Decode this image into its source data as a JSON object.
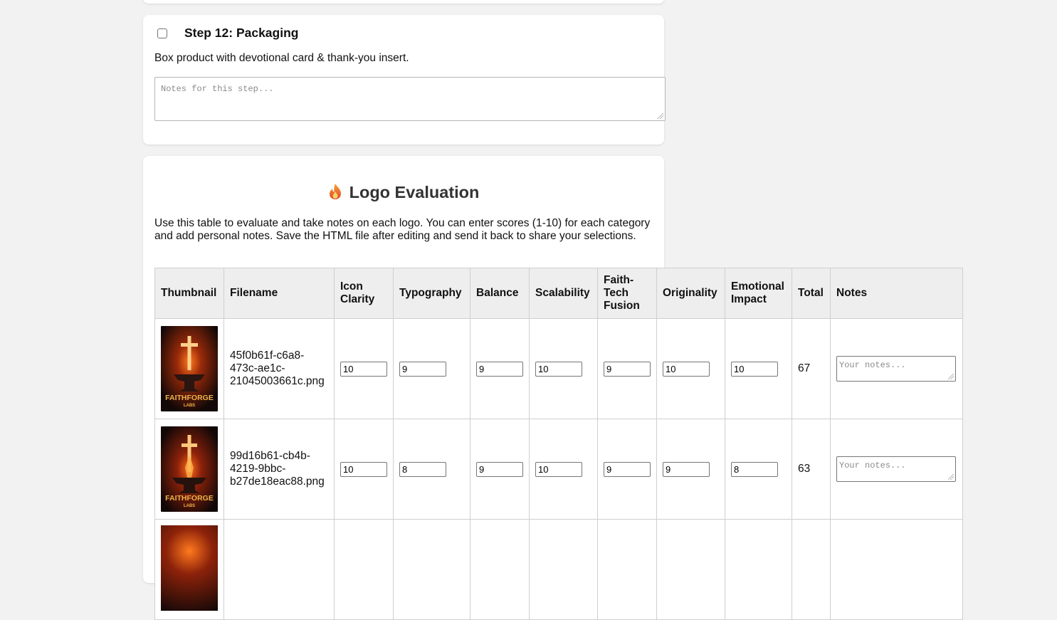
{
  "step": {
    "title": "Step 12: Packaging",
    "description": "Box product with devotional card & thank-you insert.",
    "notes_placeholder": "Notes for this step..."
  },
  "evaluation": {
    "title": "Logo Evaluation",
    "intro": "Use this table to evaluate and take notes on each logo. You can enter scores (1-10) for each category and add personal notes. Save the HTML file after editing and send it back to share your selections.",
    "columns": {
      "thumbnail": "Thumbnail",
      "filename": "Filename",
      "icon_clarity": "Icon Clarity",
      "typography": "Typography",
      "balance": "Balance",
      "scalability": "Scalability",
      "faith_tech_fusion": "Faith-Tech Fusion",
      "originality": "Originality",
      "emotional_impact": "Emotional Impact",
      "total": "Total",
      "notes": "Notes"
    },
    "notes_placeholder": "Your notes...",
    "rows": [
      {
        "filename": "45f0b61f-c6a8-473c-ae1c-21045003661c.png",
        "thumb_text": "FAITHFORGE",
        "thumb_sub": "LABS",
        "icon_clarity": "10",
        "typography": "9",
        "balance": "9",
        "scalability": "10",
        "faith_tech_fusion": "9",
        "originality": "10",
        "emotional_impact": "10",
        "total": "67"
      },
      {
        "filename": "99d16b61-cb4b-4219-9bbc-b27de18eac88.png",
        "thumb_text": "FAITHFORGE",
        "thumb_sub": "LABS",
        "icon_clarity": "10",
        "typography": "8",
        "balance": "9",
        "scalability": "10",
        "faith_tech_fusion": "9",
        "originality": "9",
        "emotional_impact": "8",
        "total": "63"
      }
    ]
  },
  "colors": {
    "page_bg": "#f2f2f2",
    "card_bg": "#ffffff",
    "header_bg": "#eeeeee",
    "title": "#333333",
    "logo_glow": "#ff6a1a",
    "logo_text": "#f2b14a"
  },
  "icons": {
    "title_icon": "flame-icon",
    "step_check": "checkbox-icon"
  }
}
